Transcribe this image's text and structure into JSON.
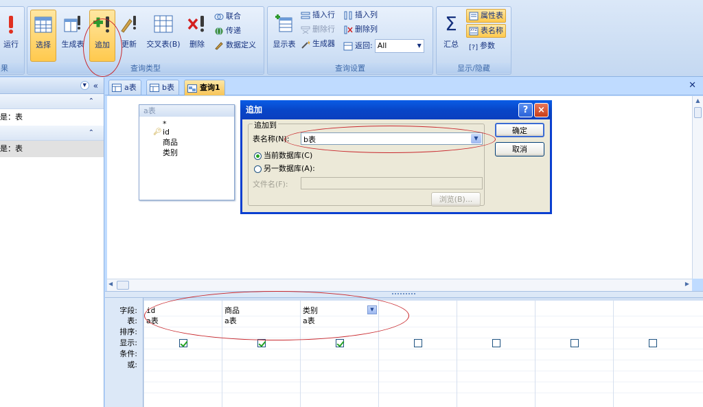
{
  "ribbon": {
    "results": {
      "run_label": "运行",
      "group_label": "果"
    },
    "query_type": {
      "group_label": "查询类型",
      "select_label": "选择",
      "make_table_label": "生成表",
      "append_label": "追加",
      "update_label": "更新",
      "crosstab_label": "交叉表(B)",
      "delete_label": "删除",
      "union_label": "联合",
      "passthrough_label": "传递",
      "data_definition_label": "数据定义"
    },
    "query_setup": {
      "group_label": "查询设置",
      "show_table_label": "显示表",
      "insert_rows_label": "插入行",
      "delete_rows_label": "删除行",
      "builder_label": "生成器",
      "insert_columns_label": "插入列",
      "delete_columns_label": "删除列",
      "return_label": "返回:",
      "return_value": "All"
    },
    "show_hide": {
      "group_label": "显示/隐藏",
      "totals_label": "汇总",
      "property_sheet_label": "属性表",
      "table_names_label": "表名称",
      "parameters_label": "参数"
    }
  },
  "nav": {
    "item1": "是：表",
    "item2": "是：表"
  },
  "tabs": [
    {
      "label": "a表"
    },
    {
      "label": "b表"
    },
    {
      "label": "查询1"
    }
  ],
  "field_list": {
    "title": "a表",
    "fields": [
      "*",
      "id",
      "商品",
      "类别"
    ]
  },
  "dialog": {
    "title": "追加",
    "help_btn": "?",
    "close_btn": "×",
    "group_label": "追加到",
    "table_name_label": "表名称(N):",
    "table_name_value": "b表",
    "current_db_label": "当前数据库(C)",
    "other_db_label": "另一数据库(A):",
    "file_name_label": "文件名(F):",
    "file_name_value": "",
    "browse_label": "浏览(B)...",
    "ok_label": "确定",
    "cancel_label": "取消"
  },
  "grid": {
    "row_labels": [
      "字段:",
      "表:",
      "排序:",
      "显示:",
      "条件:",
      "或:"
    ],
    "columns": [
      {
        "field": "id",
        "table": "a表",
        "show": true
      },
      {
        "field": "商品",
        "table": "a表",
        "show": true
      },
      {
        "field": "类别",
        "table": "a表",
        "show": true
      },
      {
        "field": "",
        "table": "",
        "show": false
      },
      {
        "field": "",
        "table": "",
        "show": false
      },
      {
        "field": "",
        "table": "",
        "show": false
      },
      {
        "field": "",
        "table": "",
        "show": false
      }
    ]
  },
  "colors": {
    "annotation_red": "#c8262b",
    "active_tab": "#f7c457",
    "dialog_title": "#0846c8"
  }
}
